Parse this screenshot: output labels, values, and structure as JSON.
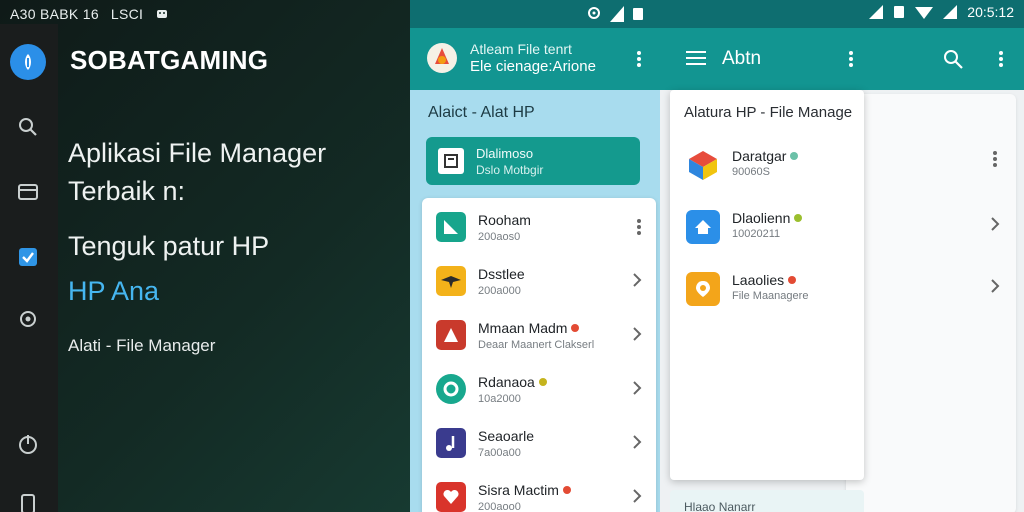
{
  "left": {
    "status_text": "A30 BABK 16",
    "status_text2": "LSCI",
    "brand": "SOBATGAMING",
    "headline1": "Aplikasi File Manager",
    "headline2": "Terbaik n:",
    "headline3": "Tenguk patur HP",
    "headline4": "HP Ana",
    "tagline": "Alati - File Manager",
    "accent": "#46b6f0"
  },
  "middle": {
    "title1": "Atleam File tenrt",
    "title2": "Ele cienage:Arione",
    "section": "Alaict - Alat HP",
    "feature": {
      "name": "Dlalimoso",
      "sub": "Dslo Motbgir"
    },
    "items": [
      {
        "name": "Rooham",
        "sub": "200aos0",
        "icon": "drive-icon",
        "action": "kebab",
        "color": "#17a58c"
      },
      {
        "name": "Dsstlee",
        "sub": "200a000",
        "icon": "bird-icon",
        "action": "chevron",
        "color": "#f3b21a"
      },
      {
        "name": "Mmaan Madm",
        "sub": "Deaar Maanert Clakserl",
        "icon": "red-app-icon",
        "action": "chevron",
        "color": "#c93a2c",
        "dot": "#e34b34"
      },
      {
        "name": "Rdanaoa",
        "sub": "10a2000",
        "icon": "ring-icon",
        "action": "chevron",
        "color": "#18a88e",
        "dot": "#c5b41e"
      },
      {
        "name": "Seaoarle",
        "sub": "7a00a00",
        "icon": "music-icon",
        "action": "chevron",
        "color": "#3a3b8e"
      },
      {
        "name": "Sisra Mactim",
        "sub": "200aoo0",
        "icon": "heart-icon",
        "action": "chevron",
        "color": "#d9342b",
        "dot": "#e34b34"
      }
    ]
  },
  "right": {
    "status_time": "20:5:12",
    "appbar_title": "Abtn",
    "card_header": "Alatura HP - File Manage",
    "items": [
      {
        "name": "Daratgar",
        "sub": "90060S",
        "icon": "cube-icon",
        "dot": "#6bc1a8"
      },
      {
        "name": "Dlaolienn",
        "sub": "10020211",
        "icon": "home-icon",
        "dot": "#9bbf2e"
      },
      {
        "name": "Laaolies",
        "sub": "File Maanagere",
        "icon": "location-icon",
        "dot": "#e34b34"
      }
    ],
    "bottom_label": "Hlaao Nanarr"
  },
  "colors": {
    "teal": "#129591",
    "teal_dark": "#0e6e70",
    "panel_bg": "#a8dcee"
  }
}
